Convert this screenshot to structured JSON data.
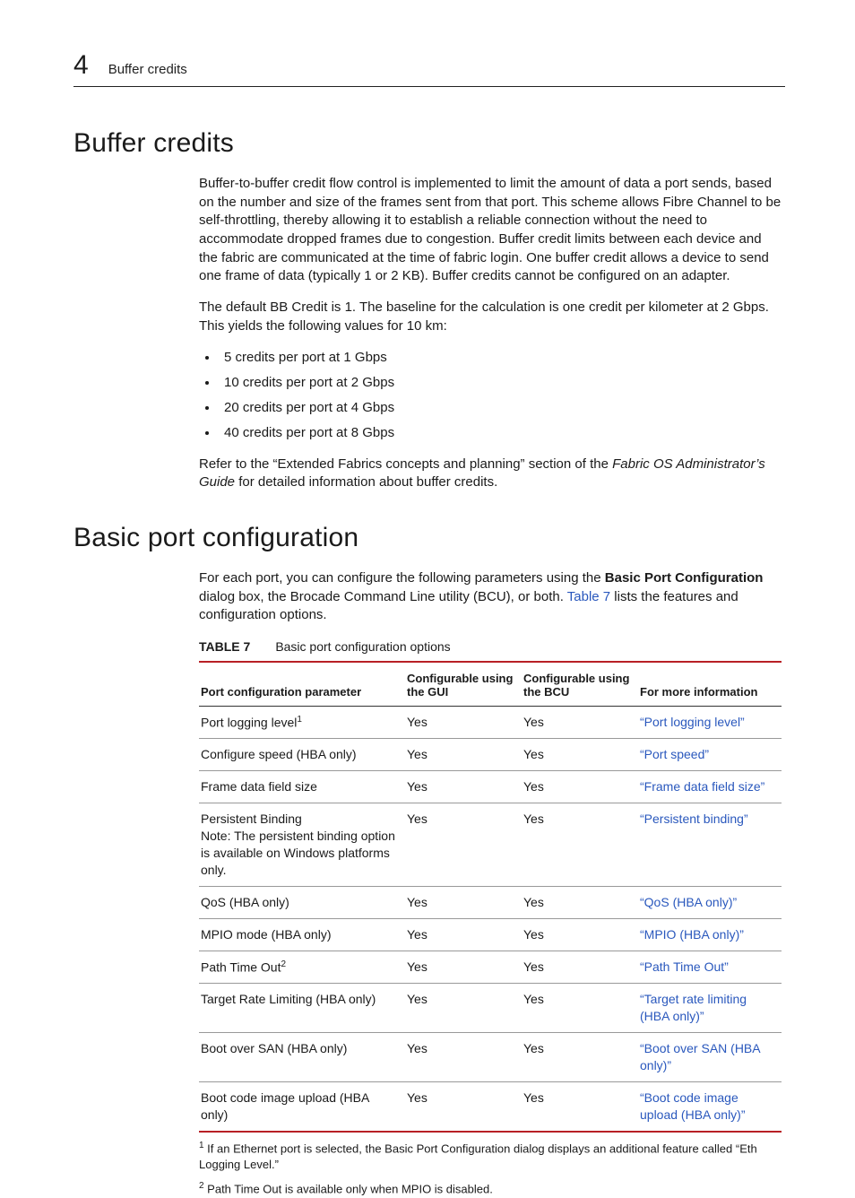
{
  "header": {
    "chapter_number": "4",
    "breadcrumb": "Buffer credits"
  },
  "section1": {
    "title": "Buffer credits",
    "p1": "Buffer-to-buffer credit flow control is implemented to limit the amount of data a port sends, based on the number and size of the frames sent from that port. This scheme allows Fibre Channel to be self-throttling, thereby allowing it to establish a reliable connection without the need to accommodate dropped frames due to congestion. Buffer credit limits between each device and the fabric are communicated at the time of fabric login. One buffer credit allows a device to send one frame of data (typically 1 or 2 KB). Buffer credits cannot be configured on an adapter.",
    "p2": "The default BB Credit is 1. The baseline for the calculation is one credit per kilometer at 2 Gbps. This yields the following values for 10 km:",
    "bullets": [
      "5 credits per port at 1 Gbps",
      "10 credits per port at 2 Gbps",
      "20 credits per port at 4 Gbps",
      "40 credits per port at 8 Gbps"
    ],
    "p3_a": "Refer to the “Extended Fabrics concepts and planning” section of the ",
    "p3_em": "Fabric OS Administrator’s Guide",
    "p3_b": " for detailed information about buffer credits."
  },
  "section2": {
    "title": "Basic port configuration",
    "intro_a": "For each port, you can configure the following parameters using the ",
    "intro_bold": "Basic Port Configuration",
    "intro_b": " dialog box, the Brocade Command Line utility (BCU), or both. ",
    "intro_link": "Table 7",
    "intro_c": " lists the features and configuration options.",
    "table": {
      "caption_label": "TABLE 7",
      "caption_text": "Basic port configuration options",
      "headers": {
        "param": "Port configuration parameter",
        "gui": "Configurable using the GUI",
        "bcu": "Configurable using the BCU",
        "info": "For more information"
      },
      "rows": [
        {
          "param": "Port logging level",
          "fn": "1",
          "gui": "Yes",
          "bcu": "Yes",
          "link": "“Port logging level”"
        },
        {
          "param": "Configure speed (HBA only)",
          "gui": "Yes",
          "bcu": "Yes",
          "link": "“Port speed”"
        },
        {
          "param": "Frame data field size",
          "gui": "Yes",
          "bcu": "Yes",
          "link": "“Frame data field size”"
        },
        {
          "param": "Persistent Binding",
          "note": "Note: The persistent binding option is available on Windows platforms only.",
          "gui": "Yes",
          "bcu": "Yes",
          "link": "“Persistent binding”"
        },
        {
          "param": "QoS (HBA only)",
          "gui": "Yes",
          "bcu": "Yes",
          "link": "“QoS (HBA only)”"
        },
        {
          "param": "MPIO mode (HBA only)",
          "gui": "Yes",
          "bcu": "Yes",
          "link": "“MPIO (HBA only)”"
        },
        {
          "param": "Path Time Out",
          "fn": "2",
          "gui": "Yes",
          "bcu": "Yes",
          "link": "“Path Time Out”"
        },
        {
          "param": "Target Rate Limiting (HBA only)",
          "gui": "Yes",
          "bcu": "Yes",
          "link": "“Target rate limiting (HBA only)”"
        },
        {
          "param": "Boot over SAN (HBA only)",
          "gui": "Yes",
          "bcu": "Yes",
          "link": "“Boot over SAN (HBA only)”"
        },
        {
          "param": "Boot code image upload (HBA only)",
          "gui": "Yes",
          "bcu": "Yes",
          "link": "“Boot code image upload (HBA only)”"
        }
      ]
    },
    "footnotes": {
      "fn1_sup": "1",
      "fn1": " If an Ethernet port is selected, the Basic Port Configuration dialog displays an additional feature called “Eth Logging Level.”",
      "fn2_sup": "2",
      "fn2": " Path Time Out is available only when MPIO is disabled."
    }
  }
}
